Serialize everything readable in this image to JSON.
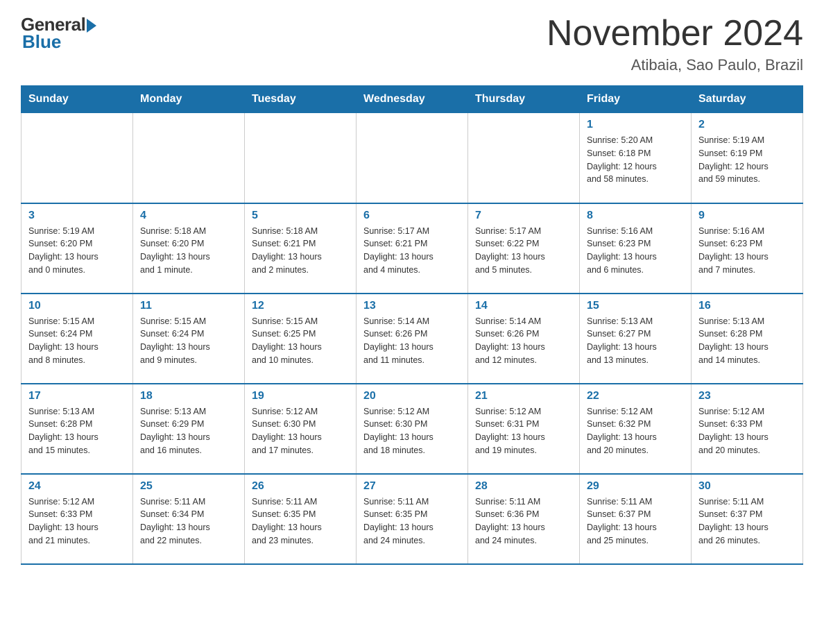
{
  "header": {
    "logo": {
      "general": "General",
      "blue": "Blue"
    },
    "title": "November 2024",
    "location": "Atibaia, Sao Paulo, Brazil"
  },
  "days_of_week": [
    "Sunday",
    "Monday",
    "Tuesday",
    "Wednesday",
    "Thursday",
    "Friday",
    "Saturday"
  ],
  "weeks": [
    [
      {
        "day": "",
        "info": ""
      },
      {
        "day": "",
        "info": ""
      },
      {
        "day": "",
        "info": ""
      },
      {
        "day": "",
        "info": ""
      },
      {
        "day": "",
        "info": ""
      },
      {
        "day": "1",
        "info": "Sunrise: 5:20 AM\nSunset: 6:18 PM\nDaylight: 12 hours\nand 58 minutes."
      },
      {
        "day": "2",
        "info": "Sunrise: 5:19 AM\nSunset: 6:19 PM\nDaylight: 12 hours\nand 59 minutes."
      }
    ],
    [
      {
        "day": "3",
        "info": "Sunrise: 5:19 AM\nSunset: 6:20 PM\nDaylight: 13 hours\nand 0 minutes."
      },
      {
        "day": "4",
        "info": "Sunrise: 5:18 AM\nSunset: 6:20 PM\nDaylight: 13 hours\nand 1 minute."
      },
      {
        "day": "5",
        "info": "Sunrise: 5:18 AM\nSunset: 6:21 PM\nDaylight: 13 hours\nand 2 minutes."
      },
      {
        "day": "6",
        "info": "Sunrise: 5:17 AM\nSunset: 6:21 PM\nDaylight: 13 hours\nand 4 minutes."
      },
      {
        "day": "7",
        "info": "Sunrise: 5:17 AM\nSunset: 6:22 PM\nDaylight: 13 hours\nand 5 minutes."
      },
      {
        "day": "8",
        "info": "Sunrise: 5:16 AM\nSunset: 6:23 PM\nDaylight: 13 hours\nand 6 minutes."
      },
      {
        "day": "9",
        "info": "Sunrise: 5:16 AM\nSunset: 6:23 PM\nDaylight: 13 hours\nand 7 minutes."
      }
    ],
    [
      {
        "day": "10",
        "info": "Sunrise: 5:15 AM\nSunset: 6:24 PM\nDaylight: 13 hours\nand 8 minutes."
      },
      {
        "day": "11",
        "info": "Sunrise: 5:15 AM\nSunset: 6:24 PM\nDaylight: 13 hours\nand 9 minutes."
      },
      {
        "day": "12",
        "info": "Sunrise: 5:15 AM\nSunset: 6:25 PM\nDaylight: 13 hours\nand 10 minutes."
      },
      {
        "day": "13",
        "info": "Sunrise: 5:14 AM\nSunset: 6:26 PM\nDaylight: 13 hours\nand 11 minutes."
      },
      {
        "day": "14",
        "info": "Sunrise: 5:14 AM\nSunset: 6:26 PM\nDaylight: 13 hours\nand 12 minutes."
      },
      {
        "day": "15",
        "info": "Sunrise: 5:13 AM\nSunset: 6:27 PM\nDaylight: 13 hours\nand 13 minutes."
      },
      {
        "day": "16",
        "info": "Sunrise: 5:13 AM\nSunset: 6:28 PM\nDaylight: 13 hours\nand 14 minutes."
      }
    ],
    [
      {
        "day": "17",
        "info": "Sunrise: 5:13 AM\nSunset: 6:28 PM\nDaylight: 13 hours\nand 15 minutes."
      },
      {
        "day": "18",
        "info": "Sunrise: 5:13 AM\nSunset: 6:29 PM\nDaylight: 13 hours\nand 16 minutes."
      },
      {
        "day": "19",
        "info": "Sunrise: 5:12 AM\nSunset: 6:30 PM\nDaylight: 13 hours\nand 17 minutes."
      },
      {
        "day": "20",
        "info": "Sunrise: 5:12 AM\nSunset: 6:30 PM\nDaylight: 13 hours\nand 18 minutes."
      },
      {
        "day": "21",
        "info": "Sunrise: 5:12 AM\nSunset: 6:31 PM\nDaylight: 13 hours\nand 19 minutes."
      },
      {
        "day": "22",
        "info": "Sunrise: 5:12 AM\nSunset: 6:32 PM\nDaylight: 13 hours\nand 20 minutes."
      },
      {
        "day": "23",
        "info": "Sunrise: 5:12 AM\nSunset: 6:33 PM\nDaylight: 13 hours\nand 20 minutes."
      }
    ],
    [
      {
        "day": "24",
        "info": "Sunrise: 5:12 AM\nSunset: 6:33 PM\nDaylight: 13 hours\nand 21 minutes."
      },
      {
        "day": "25",
        "info": "Sunrise: 5:11 AM\nSunset: 6:34 PM\nDaylight: 13 hours\nand 22 minutes."
      },
      {
        "day": "26",
        "info": "Sunrise: 5:11 AM\nSunset: 6:35 PM\nDaylight: 13 hours\nand 23 minutes."
      },
      {
        "day": "27",
        "info": "Sunrise: 5:11 AM\nSunset: 6:35 PM\nDaylight: 13 hours\nand 24 minutes."
      },
      {
        "day": "28",
        "info": "Sunrise: 5:11 AM\nSunset: 6:36 PM\nDaylight: 13 hours\nand 24 minutes."
      },
      {
        "day": "29",
        "info": "Sunrise: 5:11 AM\nSunset: 6:37 PM\nDaylight: 13 hours\nand 25 minutes."
      },
      {
        "day": "30",
        "info": "Sunrise: 5:11 AM\nSunset: 6:37 PM\nDaylight: 13 hours\nand 26 minutes."
      }
    ]
  ]
}
